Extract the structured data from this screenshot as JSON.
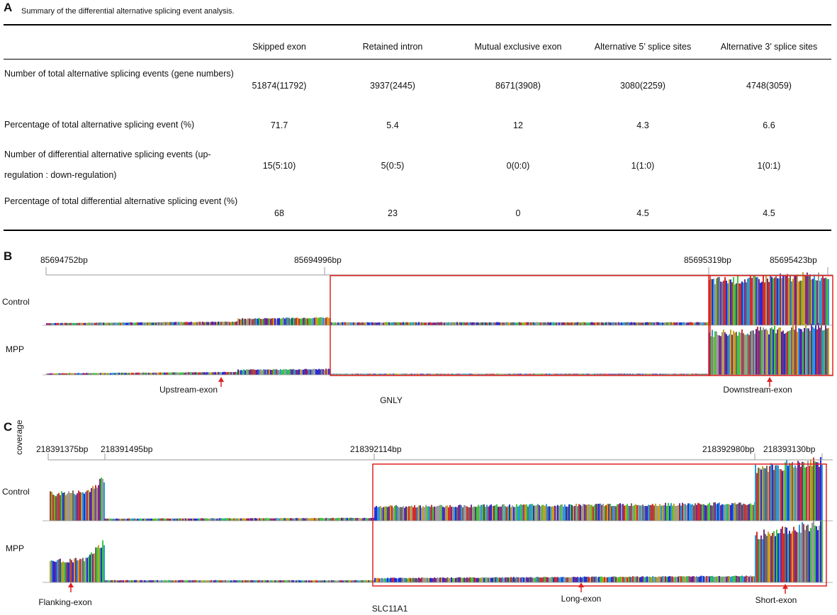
{
  "panel_a": {
    "letter": "A",
    "caption": "Summary of the differential alternative splicing event analysis.",
    "columns": [
      "Skipped exon",
      "Retained intron",
      "Mutual   exclusive exon",
      "Alternative 5’ splice sites",
      "Alternative 3’ splice sites"
    ],
    "rows": [
      {
        "label": "Number of total alternative splicing events (gene numbers)",
        "values": [
          "51874(11792)",
          "3937(2445)",
          "8671(3908)",
          "3080(2259)",
          "4748(3059)"
        ]
      },
      {
        "label": "Percentage of total alternative splicing event (%)",
        "values": [
          "71.7",
          "5.4",
          "12",
          "4.3",
          "6.6"
        ]
      },
      {
        "label": "Number of differential alternative splicing events (up-regulation : down-regulation)",
        "values": [
          "15(5:10)",
          "5(0:5)",
          "0(0:0)",
          "1(1:0)",
          "1(0:1)"
        ]
      },
      {
        "label": "Percentage of total differential alternative splicing event (%)",
        "values": [
          "68",
          "23",
          "0",
          "4.5",
          "4.5"
        ]
      }
    ]
  },
  "panel_b": {
    "letter": "B",
    "coordinates": [
      "85694752bp",
      "85694996bp",
      "85695319bp",
      "85695423bp"
    ],
    "tracks": [
      "Control",
      "MPP"
    ],
    "exon_labels": [
      "Upstream-exon",
      "Downstream-exon"
    ],
    "gene": "GNLY"
  },
  "panel_c": {
    "letter": "C",
    "axis_label": "coverage",
    "coordinates": [
      "218391375bp",
      "218391495bp",
      "218392114bp",
      "218392980bp",
      "218393130bp"
    ],
    "tracks": [
      "Control",
      "MPP"
    ],
    "exon_labels": [
      "Flanking-exon",
      "Long-exon",
      "Short-exon"
    ],
    "gene": "SLC11A1"
  },
  "colors": {
    "highlight_box": "#e02020",
    "arrow": "#e02020",
    "rule": "#000000",
    "baseline": "#999999",
    "bases": [
      "#2b2bd6",
      "#d62b2b",
      "#3cc83c",
      "#9a9a9a",
      "#7a2b8c",
      "#c8a020",
      "#2b9ad6",
      "#6a6a6a"
    ]
  }
}
